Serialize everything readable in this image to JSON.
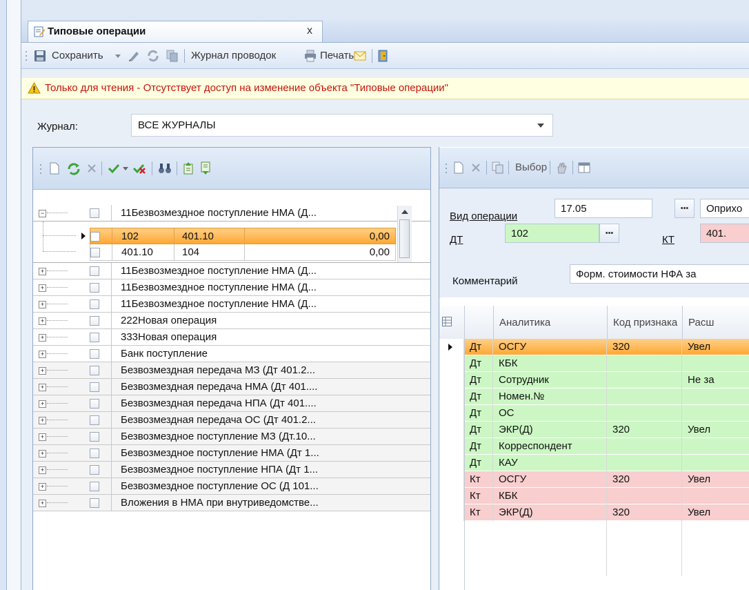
{
  "tab": {
    "title": "Типовые операции",
    "close": "x"
  },
  "toolbar": {
    "save": "Сохранить",
    "journal": "Журнал проводок",
    "print": "Печать"
  },
  "warning": "Только для чтения - Отсутствует доступ на изменение объекта \"Типовые операции\"",
  "journal": {
    "label": "Журнал:",
    "value": "ВСЕ ЖУРНАЛЫ"
  },
  "tree": {
    "expanded": {
      "label": "11Безвозмездное поступление НМА (Д...",
      "sub": [
        {
          "dt": "102",
          "kt": "401.10",
          "sum": "0,00"
        },
        {
          "dt": "401.10",
          "kt": "104",
          "sum": "0,00"
        }
      ]
    },
    "items": [
      "11Безвозмездное поступление НМА (Д...",
      "11Безвозмездное поступление НМА (Д...",
      "11Безвозмездное поступление НМА (Д...",
      "222Новая операция",
      "333Новая операция",
      "Банк поступление",
      "Безвозмездная передача МЗ (Дт 401.2...",
      "Безвозмездная передача НМА (Дт 401....",
      "Безвозмездная передача НПА (Дт 401....",
      "Безвозмездная передача ОС (Дт 401.2...",
      "Безвозмездное поступление МЗ (Дт.10...",
      "Безвозмездное поступление НМА (Дт 1...",
      "Безвозмездное поступление НПА (Дт 1...",
      "Безвозмездное поступление ОС (Д 101...",
      "Вложения в НМА при внутриведомстве..."
    ]
  },
  "right_toolbar": {
    "select": "Выбор"
  },
  "form": {
    "op_type_label": "Вид операции",
    "op_type_code": "17.05",
    "op_type_name": "Оприхо",
    "dt_label": "ДТ",
    "dt_value": "102",
    "kt_label": "КТ",
    "kt_value": "401.",
    "comment_label": "Комментарий",
    "comment_value": "Форм. стоимости НФА за"
  },
  "grid": {
    "columns": [
      "Аналитика",
      "Код признака",
      "Расш"
    ],
    "rows": [
      {
        "side": "Дт",
        "analytic": "ОСГУ",
        "code": "320",
        "ext": "Увел"
      },
      {
        "side": "Дт",
        "analytic": "КБК",
        "code": "",
        "ext": ""
      },
      {
        "side": "Дт",
        "analytic": "Сотрудник",
        "code": "",
        "ext": "Не за"
      },
      {
        "side": "Дт",
        "analytic": "Номен.№",
        "code": "",
        "ext": ""
      },
      {
        "side": "Дт",
        "analytic": "ОС",
        "code": "",
        "ext": ""
      },
      {
        "side": "Дт",
        "analytic": "ЭКР(Д)",
        "code": "320",
        "ext": "Увел"
      },
      {
        "side": "Дт",
        "analytic": "Корреспондент",
        "code": "",
        "ext": ""
      },
      {
        "side": "Дт",
        "analytic": "КАУ",
        "code": "",
        "ext": ""
      },
      {
        "side": "Кт",
        "analytic": "ОСГУ",
        "code": "320",
        "ext": "Увел"
      },
      {
        "side": "Кт",
        "analytic": "КБК",
        "code": "",
        "ext": ""
      },
      {
        "side": "Кт",
        "analytic": "ЭКР(Д)",
        "code": "320",
        "ext": "Увел"
      }
    ]
  }
}
